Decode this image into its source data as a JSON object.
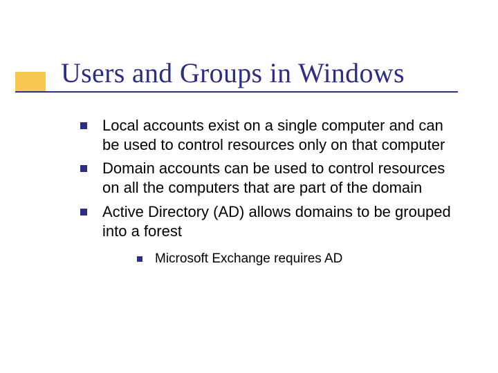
{
  "title": "Users and Groups in Windows",
  "bullets": [
    {
      "text": "Local accounts exist on a single computer and can be used to control resources only on that computer"
    },
    {
      "text": "Domain accounts can be used to control resources on all the computers that are part of the domain"
    },
    {
      "text": "Active Directory (AD) allows domains to be grouped into a forest",
      "sub": [
        {
          "text": "Microsoft Exchange requires AD"
        }
      ]
    }
  ]
}
